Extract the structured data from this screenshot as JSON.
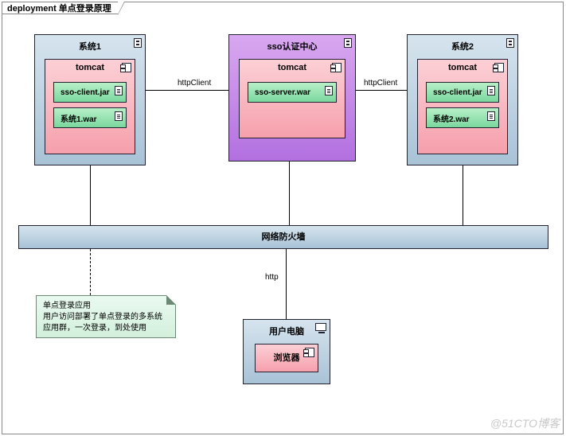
{
  "frame": {
    "title": "deployment 单点登录原理"
  },
  "nodes": {
    "sys1": {
      "title": "系统1",
      "tomcat": "tomcat",
      "artifacts": [
        "sso-client.jar",
        "系统1.war"
      ]
    },
    "sso": {
      "title": "sso认证中心",
      "tomcat": "tomcat",
      "artifacts": [
        "sso-server.war"
      ]
    },
    "sys2": {
      "title": "系统2",
      "tomcat": "tomcat",
      "artifacts": [
        "sso-client.jar",
        "系统2.war"
      ]
    }
  },
  "firewall": {
    "label": "网络防火墙"
  },
  "userpc": {
    "title": "用户电脑",
    "browser": "浏览器"
  },
  "links": {
    "sys1_sso": "httpClient",
    "sso_sys2": "httpClient",
    "firewall_userpc": "http"
  },
  "note": {
    "line1": "单点登录应用",
    "line2": "用户访问部署了单点登录的多系统应用群，一次登录，到处使用"
  },
  "watermark": "@51CTO博客"
}
